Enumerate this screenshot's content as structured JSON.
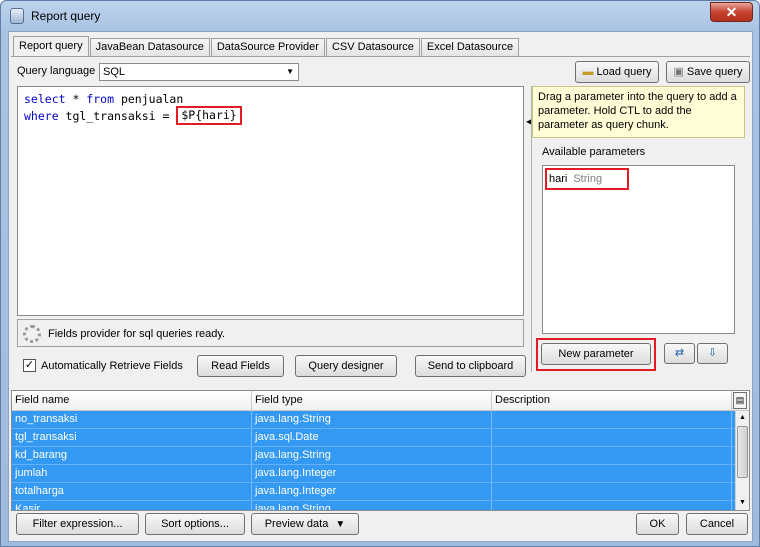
{
  "window": {
    "title": "Report query",
    "close_glyph": "✕"
  },
  "tabs": [
    {
      "label": "Report query",
      "active": true
    },
    {
      "label": "JavaBean Datasource"
    },
    {
      "label": "DataSource Provider"
    },
    {
      "label": "CSV Datasource"
    },
    {
      "label": "Excel Datasource"
    }
  ],
  "query": {
    "language_label": "Query language",
    "language_value": "SQL",
    "load_label": "Load query",
    "save_label": "Save query",
    "line1": {
      "kw1": "select",
      "mid": " * ",
      "kw2": "from",
      "rest": " penjualan"
    },
    "line2": {
      "kw": "where",
      "rest": " tgl_transaksi = ",
      "param": "$P{hari}"
    },
    "status_text": "Fields provider for sql queries ready.",
    "auto_retrieve_label": "Automatically Retrieve Fields",
    "auto_retrieve_checked": "✓",
    "read_fields_label": "Read Fields",
    "query_designer_label": "Query designer",
    "send_clipboard_label": "Send to clipboard"
  },
  "params": {
    "hint": "Drag a parameter into the query to add a parameter. Hold CTL to add the parameter as query chunk.",
    "available_label": "Available parameters",
    "items": [
      {
        "name": "hari",
        "type": "String"
      }
    ],
    "new_param_label": "New parameter"
  },
  "fields": {
    "headers": [
      "Field name",
      "Field type",
      "Description"
    ],
    "rows": [
      [
        "no_transaksi",
        "java.lang.String",
        ""
      ],
      [
        "tgl_transaksi",
        "java.sql.Date",
        ""
      ],
      [
        "kd_barang",
        "java.lang.String",
        ""
      ],
      [
        "jumlah",
        "java.lang.Integer",
        ""
      ],
      [
        "totalharga",
        "java.lang.Integer",
        ""
      ],
      [
        "Kasir",
        "java.lang.String",
        ""
      ]
    ]
  },
  "footer": {
    "filter_label": "Filter expression...",
    "sort_label": "Sort options...",
    "preview_label": "Preview data",
    "ok_label": "OK",
    "cancel_label": "Cancel"
  },
  "colors": {
    "selection": "#3399f3",
    "highlight_box": "#e21b24",
    "sql_keyword": "#0000c8"
  }
}
